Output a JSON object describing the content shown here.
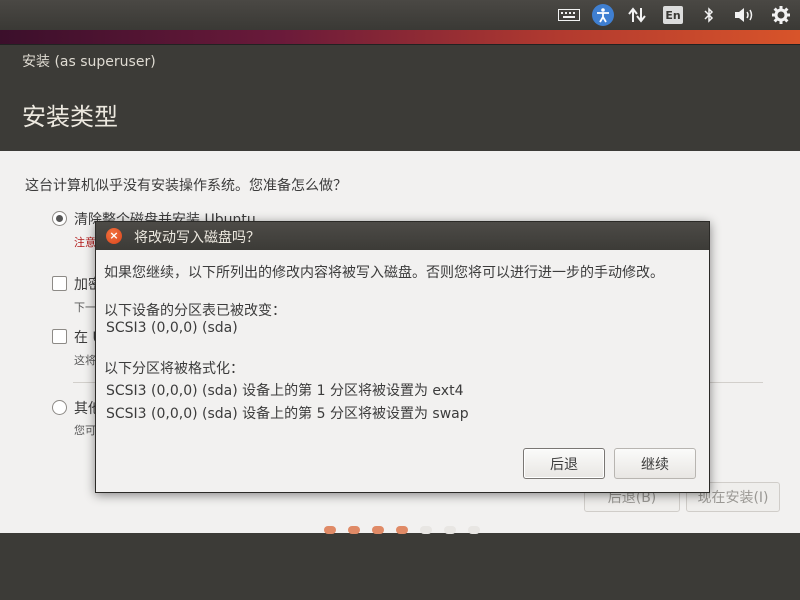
{
  "top_panel": {
    "icons": [
      "keyboard-icon",
      "accessibility-icon",
      "network-icon",
      "input-method-icon",
      "bluetooth-icon",
      "volume-icon",
      "settings-icon"
    ],
    "input_method_label": "En"
  },
  "window": {
    "title": "安装 (as superuser)",
    "heading": "安装类型",
    "question": "这台计算机似乎没有安装操作系统。您准备怎么做？",
    "options": [
      {
        "label": "清除整个磁盘并安装 Ubuntu",
        "sub": "注意",
        "selected": true,
        "type": "radio"
      },
      {
        "label": "加密",
        "sub": "下一",
        "selected": false,
        "type": "checkbox"
      },
      {
        "label": "在 U",
        "sub": "这将",
        "selected": false,
        "type": "checkbox"
      },
      {
        "label": "其他",
        "sub": "您可",
        "selected": false,
        "type": "radio"
      }
    ],
    "back_button": "后退(B)",
    "install_button": "现在安装(I)",
    "progress_dots": {
      "total": 7,
      "completed": 4,
      "colors": {
        "done": "#e08a66",
        "todo": "#e8e6e3"
      }
    }
  },
  "dialog": {
    "title": "将改动写入磁盘吗？",
    "intro": "如果您继续，以下所列出的修改内容将被写入磁盘。否则您将可以进行进一步的手动修改。",
    "partition_tables_heading": "以下设备的分区表已被改变：",
    "partition_tables": [
      "SCSI3 (0,0,0) (sda)"
    ],
    "format_heading": "以下分区将被格式化：",
    "format_items": [
      "SCSI3 (0,0,0) (sda) 设备上的第 1 分区将被设置为 ext4",
      "SCSI3 (0,0,0) (sda) 设备上的第 5 分区将被设置为 swap"
    ],
    "back_button": "后退",
    "continue_button": "继续"
  },
  "colors": {
    "panel": "#3c3b37",
    "window_bg": "#f2f1f0",
    "close_button": "#e4552a",
    "warning_text": "#b31b1b"
  }
}
